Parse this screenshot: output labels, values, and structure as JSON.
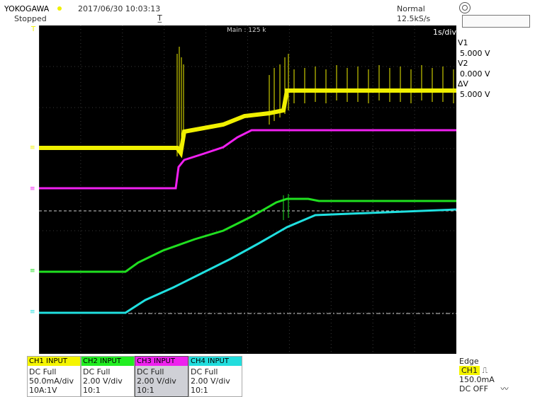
{
  "header": {
    "brand": "YOKOGAWA",
    "datetime": "2017/06/30 10:03:13",
    "status": "Stopped",
    "mode": "Normal",
    "sample_rate": "12.5kS/s"
  },
  "screen": {
    "main_label": "Main : 125 k",
    "time_div": "1s/div"
  },
  "cursors": {
    "v1_label": "V1",
    "v1_value": "5.000 V",
    "v2_label": "V2",
    "v2_value": "0.000 V",
    "dv_label": "∆V",
    "dv_value": "5.000 V"
  },
  "channels": [
    {
      "head": "CH1 INPUT",
      "coupling": "DC Full",
      "scale": "50.0mA/div",
      "probe": "10A:1V",
      "color": "#f5f500"
    },
    {
      "head": "CH2 INPUT",
      "coupling": "DC Full",
      "scale": "2.00 V/div",
      "probe": "10:1",
      "color": "#22ee22"
    },
    {
      "head": "CH3 INPUT",
      "coupling": "DC Full",
      "scale": "2.00 V/div",
      "probe": "10:1",
      "color": "#ee22ee"
    },
    {
      "head": "CH4 INPUT",
      "coupling": "DC Full",
      "scale": "2.00 V/div",
      "probe": "10:1",
      "color": "#22dddd"
    }
  ],
  "trigger": {
    "type": "Edge",
    "source": "CH1",
    "level": "150.0mA",
    "coupling": "DC OFF"
  },
  "colors": {
    "ch1": "#f0f000",
    "ch2": "#20e020",
    "ch3": "#f020f0",
    "ch4": "#20e0e0",
    "grid": "#444444"
  }
}
